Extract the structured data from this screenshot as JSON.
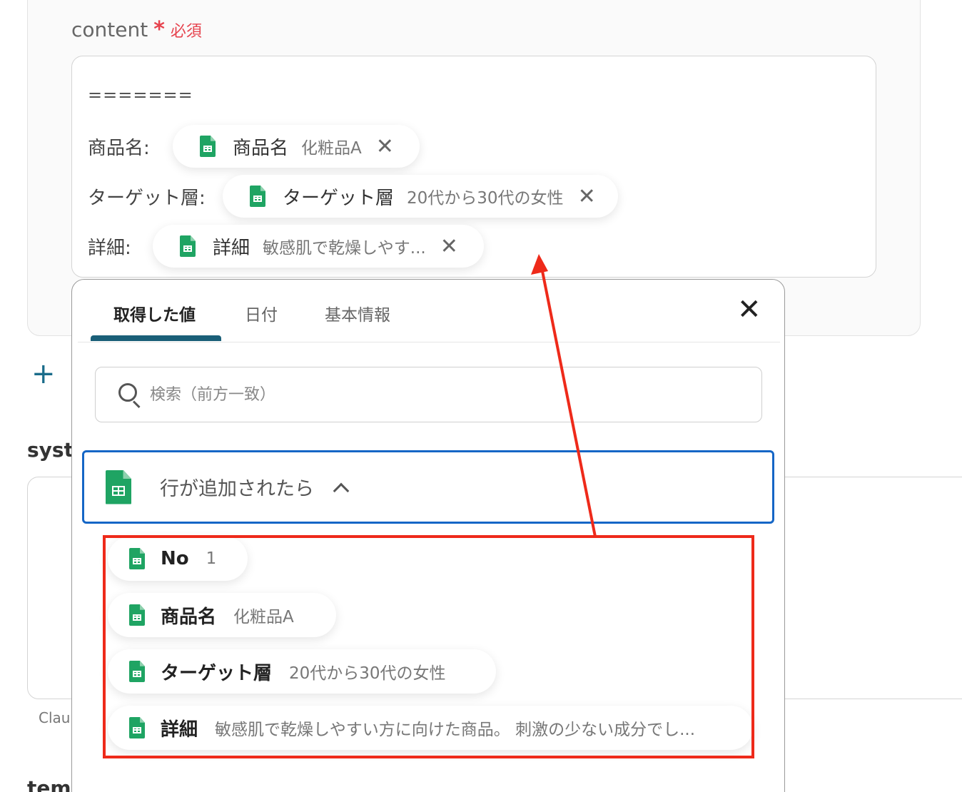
{
  "form": {
    "label": "content",
    "required_mark": "*",
    "required_text": "必須",
    "separator": "=======",
    "rows": [
      {
        "label": "商品名:",
        "chip_name": "商品名",
        "chip_value": "化粧品A",
        "chip_remove": "✕"
      },
      {
        "label": "ターゲット層:",
        "chip_name": "ターゲット層",
        "chip_value": "20代から30代の女性",
        "chip_remove": "✕"
      },
      {
        "label": "詳細:",
        "chip_name": "詳細",
        "chip_value": "敏感肌で乾燥しやす...",
        "chip_remove": "✕"
      }
    ]
  },
  "background": {
    "plus": "+",
    "section_label": "syst",
    "hint": "Clau",
    "section_label2": "temp"
  },
  "panel": {
    "tabs": [
      {
        "label": "取得した値",
        "active": true
      },
      {
        "label": "日付",
        "active": false
      },
      {
        "label": "基本情報",
        "active": false
      }
    ],
    "close": "✕",
    "search": {
      "placeholder": "検索（前方一致）"
    },
    "group": {
      "title": "行が追加されたら",
      "icon": "google-sheets-icon"
    },
    "items": [
      {
        "name": "No",
        "value": "1"
      },
      {
        "name": "商品名",
        "value": "化粧品A"
      },
      {
        "name": "ターゲット層",
        "value": "20代から30代の女性"
      },
      {
        "name": "詳細",
        "value": "敏感肌で乾燥しやすい方に向けた商品。 刺激の少ない成分でし..."
      }
    ]
  },
  "colors": {
    "required": "#e6434e",
    "tab_underline": "#1a5f78",
    "group_border": "#1566c6",
    "highlight": "#ee2a1a",
    "sheets_green": "#1fa463"
  }
}
